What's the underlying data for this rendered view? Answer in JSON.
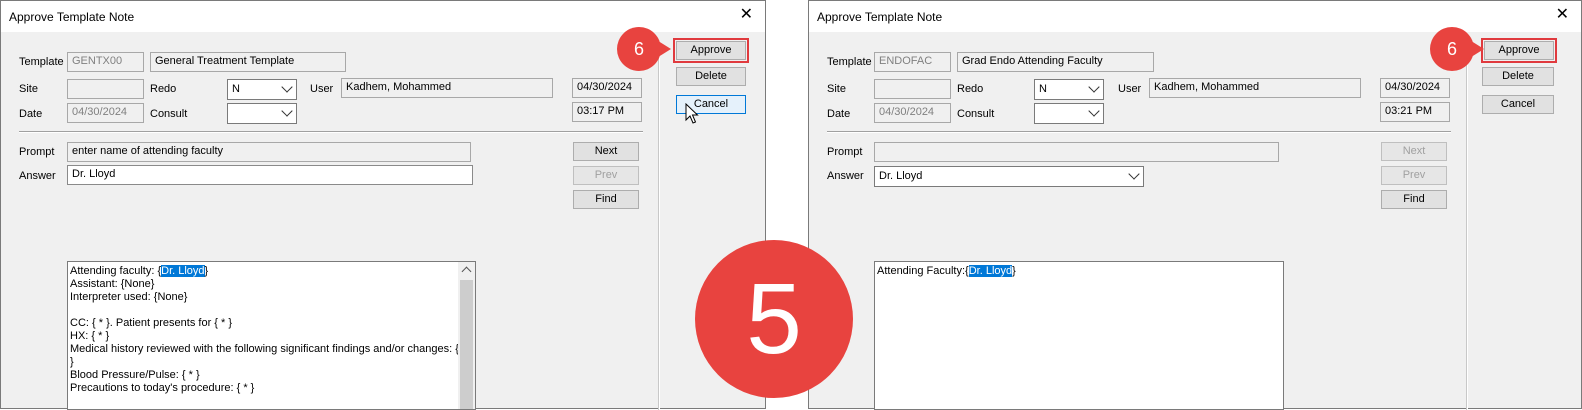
{
  "step_badge": "5",
  "left": {
    "title": "Approve Template Note",
    "labels": {
      "template": "Template",
      "site": "Site",
      "date": "Date",
      "redo": "Redo",
      "consult": "Consult",
      "user": "User",
      "prompt": "Prompt",
      "answer": "Answer"
    },
    "template_code": "GENTX00",
    "template_name": "General Treatment Template",
    "site": "",
    "date_value": "04/30/2024",
    "redo_value": "N",
    "consult_value": "",
    "user_value": "Kadhem, Mohammed",
    "date_right": "04/30/2024",
    "time_right": "03:17 PM",
    "prompt_value": "enter name of attending faculty",
    "answer_value": "Dr. Lloyd",
    "buttons": {
      "approve": "Approve",
      "delete": "Delete",
      "cancel": "Cancel",
      "next": "Next",
      "prev": "Prev",
      "find": "Find"
    },
    "marker": "6",
    "note": {
      "line1_prefix": "Attending faculty: {",
      "line1_sel": "Dr. Lloyd",
      "line1_suffix": "}",
      "lines": [
        "Assistant: {None}",
        "Interpreter used: {None}",
        "",
        "CC: { * }. Patient presents for { * }",
        "HX: { * }",
        "Medical history reviewed with the following significant findings and/or changes: { *",
        "}",
        "Blood Pressure/Pulse: { * }",
        "Precautions to today's procedure: { * }"
      ]
    }
  },
  "right": {
    "title": "Approve Template Note",
    "labels": {
      "template": "Template",
      "site": "Site",
      "date": "Date",
      "redo": "Redo",
      "consult": "Consult",
      "user": "User",
      "prompt": "Prompt",
      "answer": "Answer"
    },
    "template_code": "ENDOFAC",
    "template_name": "Grad Endo Attending Faculty",
    "site": "",
    "date_value": "04/30/2024",
    "redo_value": "N",
    "consult_value": "",
    "user_value": "Kadhem, Mohammed",
    "date_right": "04/30/2024",
    "time_right": "03:21 PM",
    "prompt_value": "",
    "answer_value": "Dr. Lloyd",
    "buttons": {
      "approve": "Approve",
      "delete": "Delete",
      "cancel": "Cancel",
      "next": "Next",
      "prev": "Prev",
      "find": "Find"
    },
    "marker": "6",
    "note": {
      "line1_prefix": "Attending Faculty:{",
      "line1_sel": "Dr. Lloyd",
      "line1_suffix": "}"
    }
  }
}
